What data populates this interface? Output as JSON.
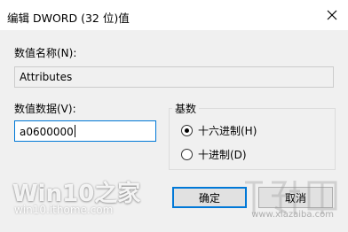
{
  "window": {
    "title": "编辑 DWORD (32 位)值",
    "close_icon": "close-icon"
  },
  "value_name": {
    "label": "数值名称(N):",
    "value": "Attributes"
  },
  "value_data": {
    "label": "数值数据(V):",
    "value": "a0600000"
  },
  "base": {
    "title": "基数",
    "options": [
      {
        "label": "十六进制(H)",
        "checked": true
      },
      {
        "label": "十进制(D)",
        "checked": false
      }
    ]
  },
  "buttons": {
    "ok": "确定",
    "cancel": "取消"
  },
  "watermarks": {
    "logo": "Win10之家",
    "site": "win10.ithome.com",
    "right_site": "www.xiazaiba.com"
  },
  "colors": {
    "focus_border": "#0078d7",
    "client_bg": "#f0f0f0"
  }
}
